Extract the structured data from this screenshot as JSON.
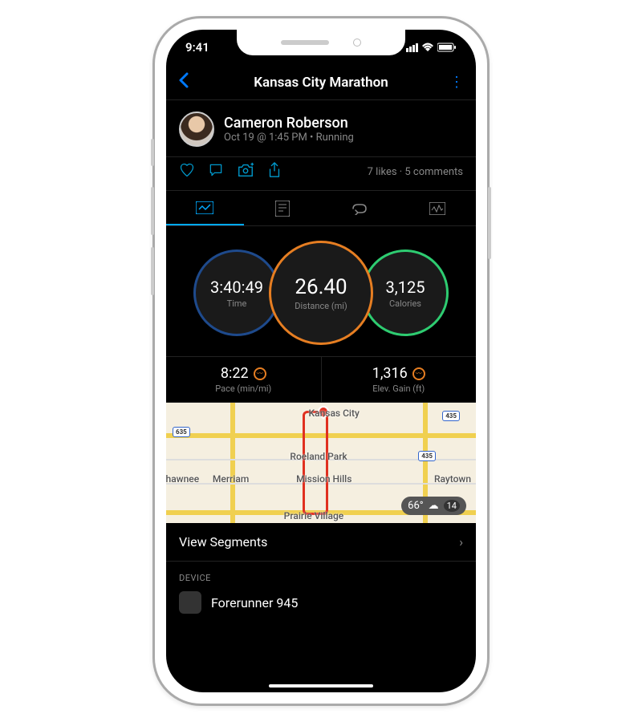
{
  "status": {
    "time": "9:41"
  },
  "nav": {
    "title": "Kansas City Marathon"
  },
  "profile": {
    "name": "Cameron Roberson",
    "meta": "Oct 19 @ 1:45 PM • Running"
  },
  "social": {
    "likes_count": "7 likes",
    "comments_count": "5 comments"
  },
  "stats": {
    "time_value": "3:40:49",
    "time_label": "Time",
    "distance_value": "26.40",
    "distance_label": "Distance (mi)",
    "calories_value": "3,125",
    "calories_label": "Calories",
    "pace_value": "8:22",
    "pace_label": "Pace (min/mi)",
    "elev_value": "1,316",
    "elev_label": "Elev. Gain (ft)"
  },
  "map": {
    "city_label": "Kansas City",
    "places": [
      "Roeland Park",
      "Mission Hills",
      "Merriam",
      "Shawnee",
      "Raytown",
      "Prairie Village"
    ],
    "highways": [
      "635",
      "435",
      "435"
    ]
  },
  "weather": {
    "temp": "66°",
    "extra": "14"
  },
  "segments": {
    "label": "View Segments"
  },
  "device": {
    "header": "DEVICE",
    "name": "Forerunner 945"
  }
}
